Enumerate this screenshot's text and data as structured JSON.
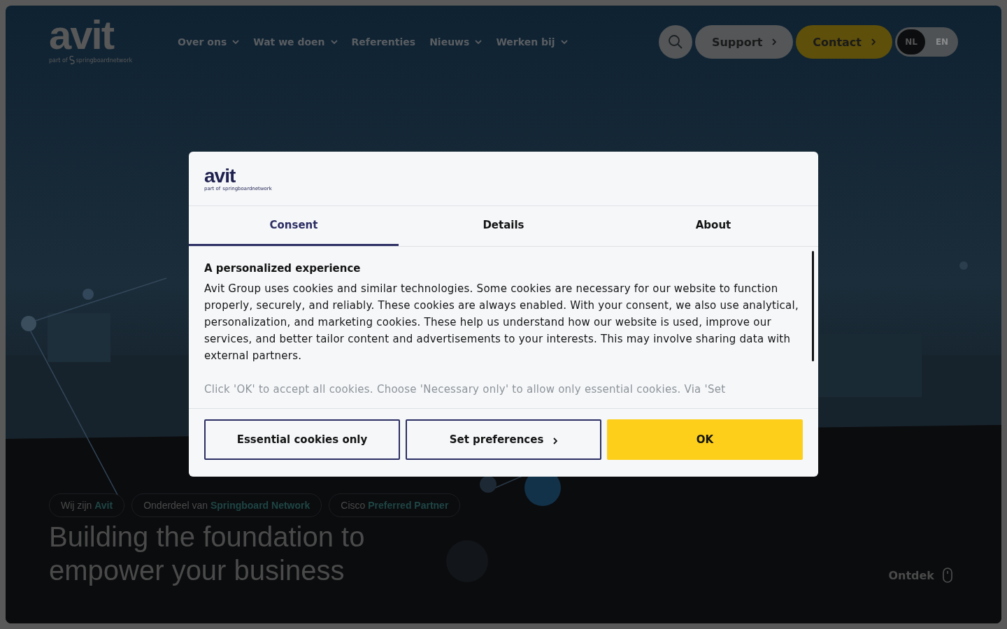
{
  "header": {
    "logo": {
      "wordmark": "avit",
      "tagline_prefix": "part of",
      "tagline_brand": "springboardnetwork"
    },
    "nav": [
      {
        "label": "Over ons",
        "has_dropdown": true
      },
      {
        "label": "Wat we doen",
        "has_dropdown": true
      },
      {
        "label": "Referenties",
        "has_dropdown": false
      },
      {
        "label": "Nieuws",
        "has_dropdown": true
      },
      {
        "label": "Werken bij",
        "has_dropdown": true
      }
    ],
    "buttons": [
      {
        "label": "Support",
        "kind": "grey"
      },
      {
        "label": "Contact",
        "kind": "yellow"
      }
    ],
    "languages": [
      {
        "label": "NL",
        "selected": true
      },
      {
        "label": "EN",
        "selected": false
      }
    ]
  },
  "hero": {
    "badges": [
      {
        "prefix": "Wij zijn",
        "highlight": "Avit"
      },
      {
        "prefix": "Onderdeel van",
        "highlight": "Springboard Network"
      },
      {
        "prefix": "Cisco",
        "highlight": "Preferred Partner"
      }
    ],
    "headline": [
      "Building the foundation to",
      "empower your business"
    ],
    "discover": "Ontdek"
  },
  "dialog": {
    "logo": {
      "wordmark": "avit",
      "tagline_prefix": "part of",
      "tagline_brand": "springboardnetwork"
    },
    "tabs": [
      {
        "label": "Consent",
        "selected": true
      },
      {
        "label": "Details",
        "selected": false
      },
      {
        "label": "About",
        "selected": false
      }
    ],
    "heading": "A personalized experience",
    "paragraphs": [
      "Avit Group uses cookies and similar technologies. Some cookies are necessary for our website to function properly, securely, and reliably. These cookies are always enabled. With your consent, we also use analytical, personalization, and marketing cookies. These help us understand how our website is used, improve our services, and better tailor content and advertisements to your interests. This may involve sharing data with external partners.",
      "Click 'OK' to accept all cookies. Choose 'Necessary only' to allow only essential cookies. Via 'Set"
    ],
    "buttons": [
      {
        "label": "Essential cookies only",
        "kind": "outline"
      },
      {
        "label": "Set preferences",
        "kind": "outline-chevron"
      },
      {
        "label": "OK",
        "kind": "primary"
      }
    ]
  }
}
